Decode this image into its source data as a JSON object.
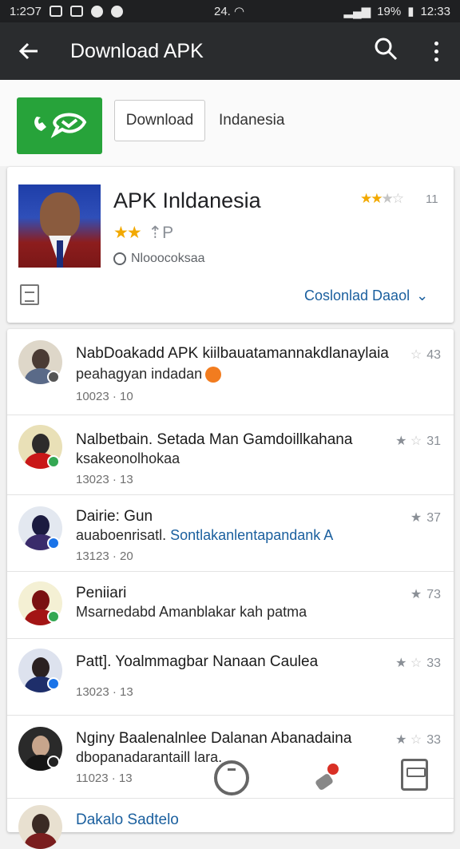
{
  "status_bar": {
    "time_left": "1:2Ɔ7",
    "signal_text": "24.",
    "battery": "19%",
    "clock": "12:33"
  },
  "app_bar": {
    "title": "Download APK"
  },
  "top_strip": {
    "download_label": "Download",
    "language_label": "Indanesia"
  },
  "app_card": {
    "name": "APK Inldanesia",
    "rating_count": "11",
    "meta_text": "Nlooocoksaa",
    "download_link": "Coslonlad Daaol"
  },
  "reviews": [
    {
      "title": "NabDoakadd APK kiilbauatamannakdlanaylaia",
      "subtitle": "peahagyan indadan",
      "date": "10023 · 10",
      "rating": "43",
      "avatar_colors": [
        "#ded7c9",
        "#4a3b34",
        "#5a6a88"
      ],
      "badge_color": "#555555"
    },
    {
      "title": "Nalbetbain. Setada Man Gamdoillkahana",
      "subtitle": "ksakeonolhokaa",
      "date": "13023 · 13",
      "rating": "31",
      "avatar_colors": [
        "#e9e0b7",
        "#2d2b2b",
        "#c91818"
      ],
      "badge_color": "#34a853"
    },
    {
      "title": "Dairie: Gun",
      "subtitle": "auaboenrisatl.",
      "subtitle_accent": "Sontlakanlentapandank A",
      "date": "13123 · 20",
      "rating": "37",
      "avatar_colors": [
        "#e3e8f0",
        "#1b1b40",
        "#3a2c6b"
      ],
      "badge_color": "#1a73e8"
    },
    {
      "title": "Peniiari",
      "subtitle": "Msarnedabd Amanblakar kah patma",
      "date": "",
      "rating": "73",
      "avatar_colors": [
        "#f4f0d4",
        "#7a1111",
        "#a31515"
      ],
      "badge_color": "#34a853"
    },
    {
      "title": "Patt]. Yoalmmagbar Nanaan Caulea",
      "subtitle": "",
      "date": "13023 · 13",
      "rating": "33",
      "avatar_colors": [
        "#dde2ee",
        "#2a2020",
        "#1e2e6a"
      ],
      "badge_color": "#1a73e8"
    },
    {
      "title": "Nginy Baalenalnlee Dalanan Abanadaina",
      "subtitle": "dbopanadarantaill",
      "subtitle_tail": "lara.",
      "date": "11023 · 13",
      "rating": "33",
      "avatar_colors": [
        "#2a2a2a",
        "#c7a58c",
        "#151515"
      ],
      "badge_color": "#222222"
    },
    {
      "title": "Dakalo Sadtelo",
      "subtitle": "",
      "date": "",
      "rating": "",
      "avatar_colors": [
        "#e8e0d0",
        "#3a2a24",
        "#7a1e1e"
      ],
      "badge_color": "#555555"
    }
  ],
  "colors": {
    "app_bar": "#2a2c2e",
    "accent_blue": "#1a5f9e",
    "star_gold": "#f2a900",
    "logo_green": "#27a33a"
  }
}
